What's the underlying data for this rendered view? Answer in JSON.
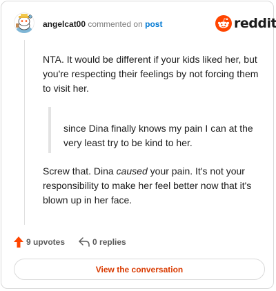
{
  "comment": {
    "username": "angelcat00",
    "action_text": "commented on",
    "post_link_text": "post",
    "paragraphs": [
      "NTA. It would be different if your kids liked her, but you're respecting their feelings by not forcing them to visit her."
    ],
    "quote": "since Dina finally knows my pain I can at the very least try to be kind to her.",
    "final_paragraph": {
      "before": "Screw that. Dina ",
      "emphasis": "caused",
      "after": " your pain. It's not your responsibility to make her feel better now that it's blown up in her face."
    }
  },
  "brand": {
    "wordmark": "reddit",
    "color": "#ff4500"
  },
  "actions": {
    "upvotes_label": "9 upvotes",
    "replies_label": "0 replies"
  },
  "cta": {
    "label": "View the conversation"
  },
  "icons": [
    "user-avatar",
    "reddit-logo-icon",
    "upvote-arrow-icon",
    "reply-arrow-icon"
  ],
  "colors": {
    "accent_link": "#0079d3",
    "cta_text": "#d93a00",
    "upvote": "#ff4500"
  }
}
